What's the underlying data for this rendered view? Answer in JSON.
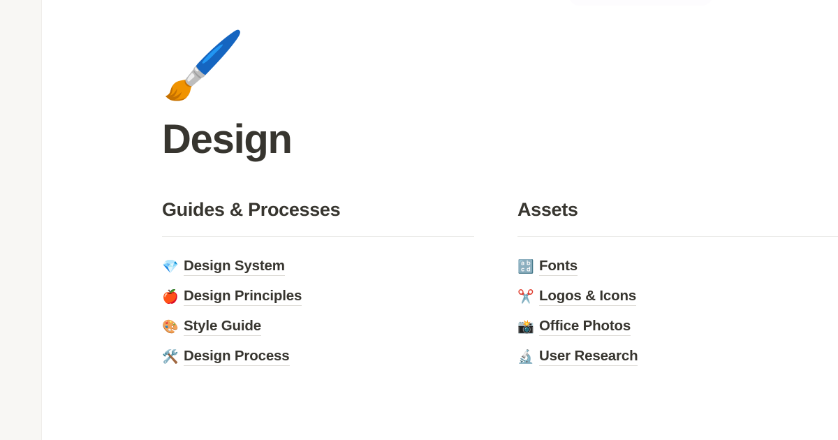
{
  "window": {
    "background_color": "#ffffff",
    "sidebar_color": "#f8f7f4",
    "text_color": "#37352f",
    "divider_color": "#e9e9e7",
    "link_underline_color": "#dedcd7"
  },
  "page": {
    "emoji": "🖌️",
    "emoji_name": "paintbrush-emoji",
    "title": "Design"
  },
  "columns": [
    {
      "id": "guides-and-processes",
      "heading": "Guides & Processes",
      "links": [
        {
          "emoji": "💎",
          "emoji_name": "gem-stone-emoji",
          "label": "Design System"
        },
        {
          "emoji": "🍎",
          "emoji_name": "red-apple-emoji",
          "label": "Design Principles"
        },
        {
          "emoji": "🎨",
          "emoji_name": "artist-palette-emoji",
          "label": "Style Guide"
        },
        {
          "emoji": "🛠️",
          "emoji_name": "hammer-and-wrench-emoji",
          "label": "Design Process"
        }
      ]
    },
    {
      "id": "assets",
      "heading": "Assets",
      "links": [
        {
          "emoji": "🔡",
          "emoji_name": "input-latin-lowercase-emoji",
          "label": "Fonts"
        },
        {
          "emoji": "✂️",
          "emoji_name": "scissors-emoji",
          "label": "Logos & Icons"
        },
        {
          "emoji": "📸",
          "emoji_name": "camera-with-flash-emoji",
          "label": "Office Photos"
        },
        {
          "emoji": "🔬",
          "emoji_name": "microscope-emoji",
          "label": "User Research"
        }
      ]
    }
  ]
}
